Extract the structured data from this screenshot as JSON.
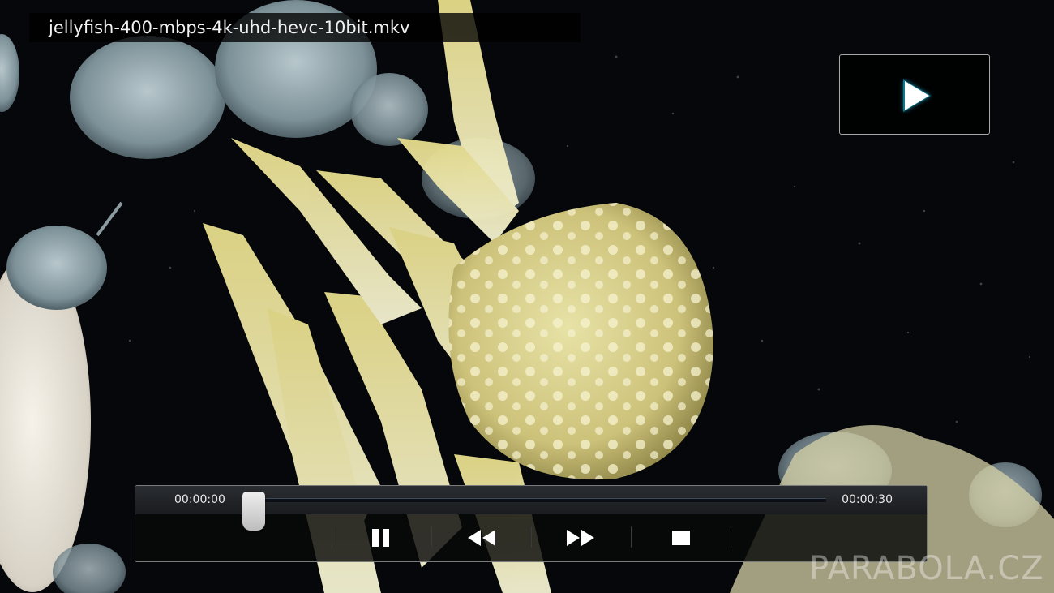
{
  "player": {
    "filename": "jellyfish-400-mbps-4k-uhd-hevc-10bit.mkv",
    "current_time": "00:00:00",
    "total_time": "00:00:30",
    "progress": 0.0,
    "play_icon": "play-icon",
    "accent_color": "#2d6fb3"
  },
  "controls": {
    "pause_icon": "pause-icon",
    "rewind_icon": "rewind-icon",
    "fast_forward_icon": "fast-forward-icon",
    "stop_icon": "stop-icon"
  },
  "watermark": {
    "text": "PARABOLA.CZ"
  }
}
